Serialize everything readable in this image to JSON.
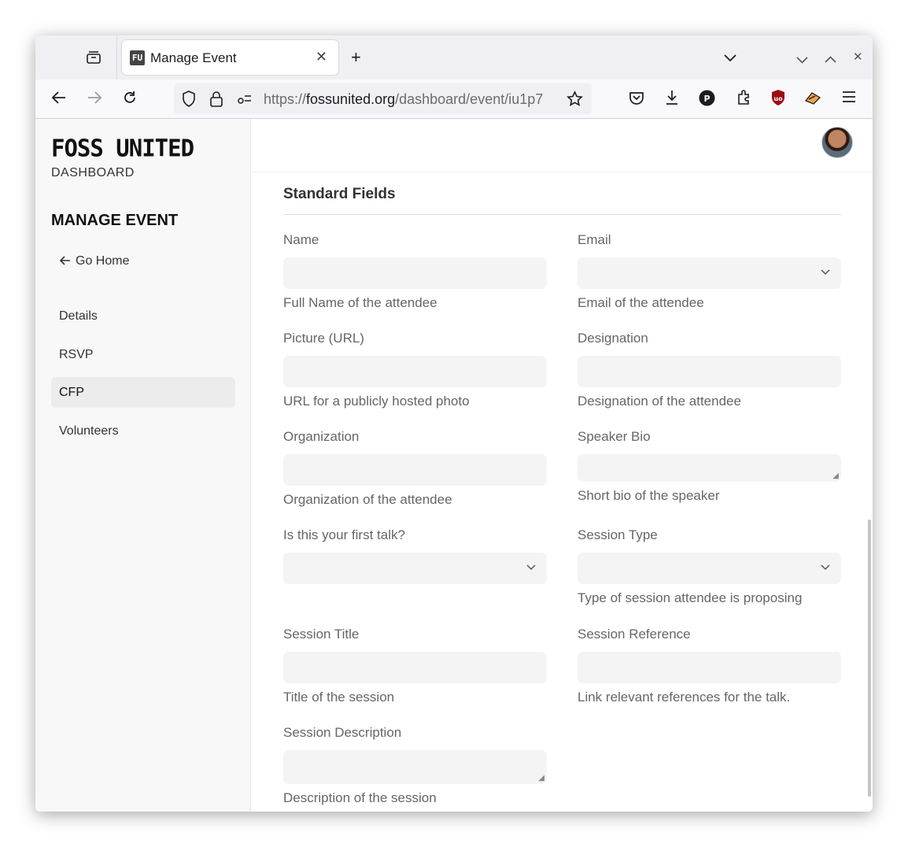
{
  "browser": {
    "tab_title": "Manage Event",
    "tab_favicon": "FU",
    "url_prefix": "https://",
    "url_domain": "fossunited.org",
    "url_path": "/dashboard/event/iu1p7",
    "icons": [
      "tab-overview-icon",
      "close-icon",
      "new-tab-icon",
      "list-tabs-icon",
      "minimize-icon",
      "maximize-icon",
      "window-close-icon",
      "back-icon",
      "forward-icon",
      "reload-icon",
      "shield-icon",
      "lock-icon",
      "permissions-icon",
      "bookmark-star-icon",
      "pocket-icon",
      "download-icon",
      "profile-p-icon",
      "extensions-icon",
      "ublock-icon",
      "extension-icon",
      "menu-icon"
    ]
  },
  "sidebar": {
    "logo": "FOSS UNITED",
    "subtitle": "DASHBOARD",
    "heading": "MANAGE EVENT",
    "go_home": "Go Home",
    "items": [
      {
        "label": "Details"
      },
      {
        "label": "RSVP"
      },
      {
        "label": "CFP"
      },
      {
        "label": "Volunteers"
      }
    ],
    "active_item": "CFP"
  },
  "main": {
    "section_title": "Standard Fields",
    "fields": [
      {
        "label": "Name",
        "help": "Full Name of the attendee",
        "type": "input"
      },
      {
        "label": "Email",
        "help": "Email of the attendee",
        "type": "select"
      },
      {
        "label": "Picture (URL)",
        "help": "URL for a publicly hosted photo",
        "type": "input"
      },
      {
        "label": "Designation",
        "help": "Designation of the attendee",
        "type": "input"
      },
      {
        "label": "Organization",
        "help": "Organization of the attendee",
        "type": "input"
      },
      {
        "label": "Speaker Bio",
        "help": "Short bio of the speaker",
        "type": "textarea"
      },
      {
        "label": "Is this your first talk?",
        "help": "",
        "type": "select"
      },
      {
        "label": "Session Type",
        "help": "Type of session attendee is proposing",
        "type": "select"
      },
      {
        "label": "Session Title",
        "help": "Title of the session",
        "type": "input"
      },
      {
        "label": "Session Reference",
        "help": "Link relevant references for the talk.",
        "type": "input"
      },
      {
        "label": "Session Description",
        "help": "Description of the session",
        "type": "textarea"
      }
    ]
  }
}
